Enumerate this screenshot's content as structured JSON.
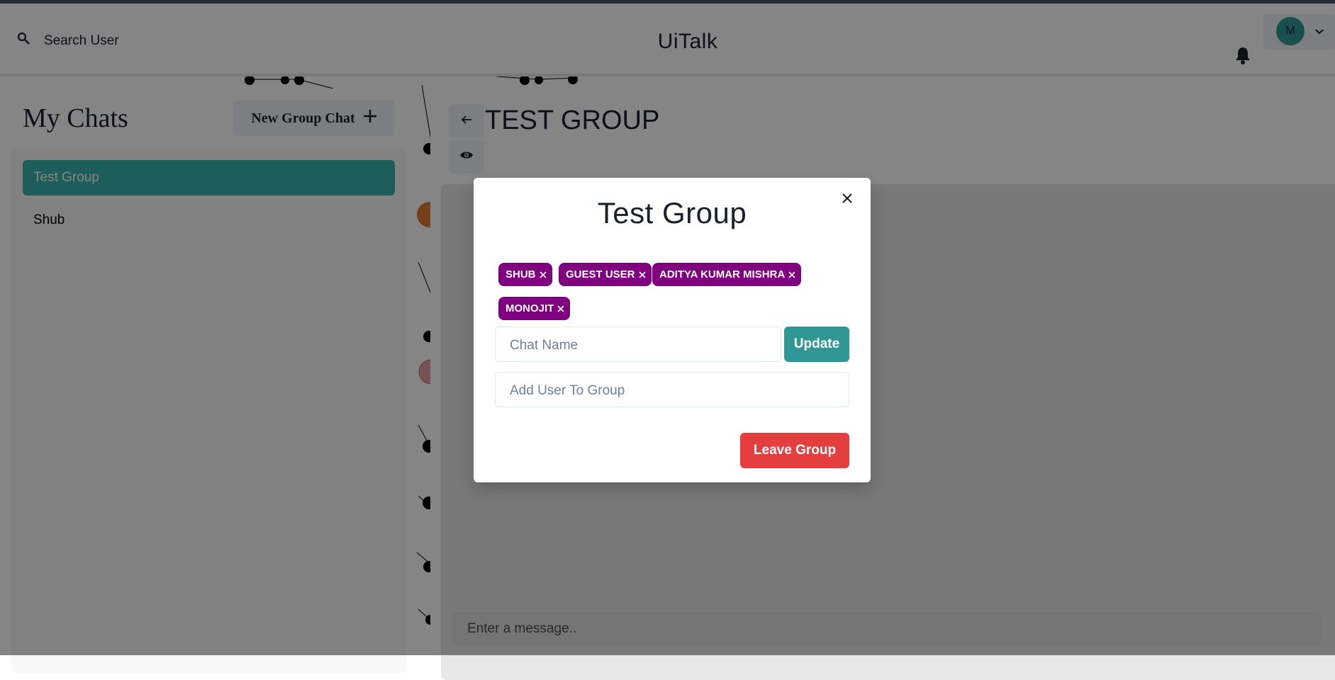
{
  "header": {
    "search_label": "Search User",
    "app_title": "UiTalk",
    "avatar_initial": "M"
  },
  "sidebar": {
    "title": "My Chats",
    "new_group_label": "New Group Chat",
    "chats": [
      {
        "name": "Test Group",
        "active": true
      },
      {
        "name": "Shub",
        "active": false
      }
    ]
  },
  "chat": {
    "title": "TEST GROUP",
    "message_placeholder": "Enter a message.."
  },
  "modal": {
    "title": "Test Group",
    "members": [
      "SHUB",
      "GUEST USER",
      "ADITYA KUMAR MISHRA",
      "MONOJIT"
    ],
    "chat_name_placeholder": "Chat Name",
    "update_label": "Update",
    "add_user_placeholder": "Add User To Group",
    "leave_label": "Leave Group"
  },
  "colors": {
    "accent": "#319795",
    "active_chat": "#38b2ac",
    "badge": "#800080",
    "danger": "#e53e3e"
  },
  "icons": [
    "search-icon",
    "bell-icon",
    "chevron-down-icon",
    "plus-icon",
    "arrow-left-icon",
    "eye-icon",
    "close-icon"
  ]
}
